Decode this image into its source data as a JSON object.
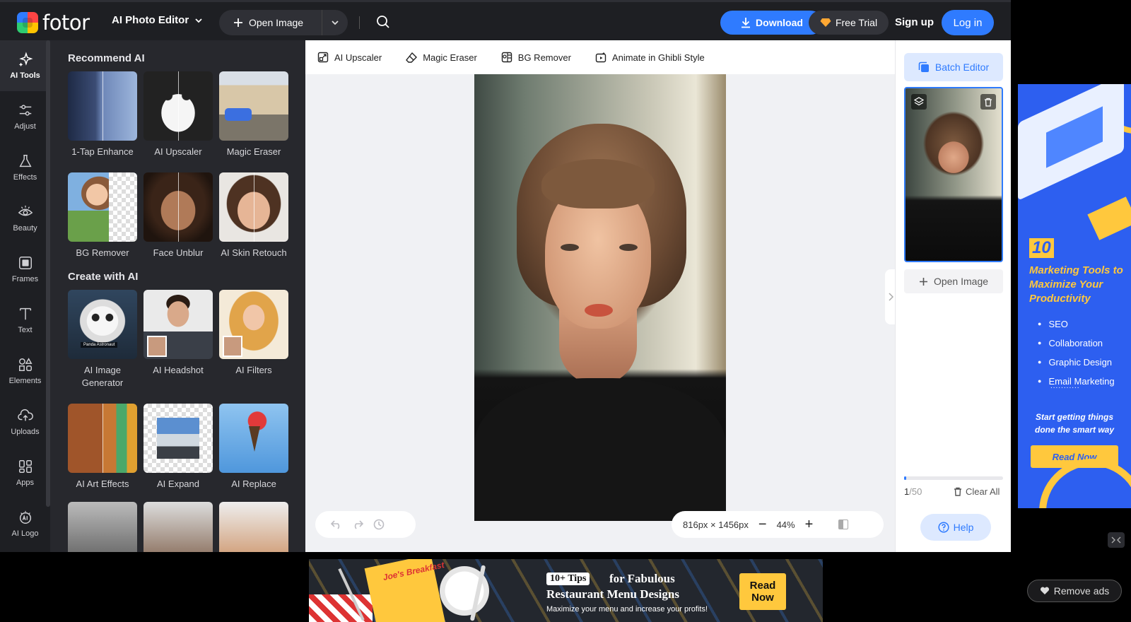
{
  "brand": {
    "name": "fotor"
  },
  "topbar": {
    "editor_menu": "AI Photo Editor",
    "open_image": "Open Image",
    "download": "Download",
    "free_trial": "Free Trial",
    "sign_up": "Sign up",
    "log_in": "Log in"
  },
  "rail": {
    "items": [
      {
        "label": "AI Tools",
        "icon": "sparkle-icon",
        "active": true
      },
      {
        "label": "Adjust",
        "icon": "sliders-icon"
      },
      {
        "label": "Effects",
        "icon": "flask-icon"
      },
      {
        "label": "Beauty",
        "icon": "eye-icon"
      },
      {
        "label": "Frames",
        "icon": "frame-icon"
      },
      {
        "label": "Text",
        "icon": "text-icon"
      },
      {
        "label": "Elements",
        "icon": "shapes-icon"
      },
      {
        "label": "Uploads",
        "icon": "cloud-upload-icon"
      },
      {
        "label": "Apps",
        "icon": "apps-icon"
      },
      {
        "label": "AI Logo",
        "icon": "ai-logo-icon"
      }
    ]
  },
  "panel": {
    "recommend_title": "Recommend AI",
    "recommend": [
      {
        "label": "1-Tap Enhance"
      },
      {
        "label": "AI Upscaler"
      },
      {
        "label": "Magic Eraser"
      },
      {
        "label": "BG Remover"
      },
      {
        "label": "Face Unblur"
      },
      {
        "label": "AI Skin Retouch"
      }
    ],
    "create_title": "Create with AI",
    "create": [
      {
        "label": "AI Image Generator",
        "badge": "Panda Astronaut"
      },
      {
        "label": "AI Headshot"
      },
      {
        "label": "AI Filters"
      },
      {
        "label": "AI Art Effects"
      },
      {
        "label": "AI Expand"
      },
      {
        "label": "AI Replace"
      }
    ]
  },
  "quickbar": {
    "items": [
      {
        "label": "AI Upscaler",
        "icon": "upscale-icon"
      },
      {
        "label": "Magic Eraser",
        "icon": "eraser-icon"
      },
      {
        "label": "BG Remover",
        "icon": "bg-remove-icon"
      },
      {
        "label": "Animate in Ghibli Style",
        "icon": "animate-icon"
      }
    ]
  },
  "canvas": {
    "dimensions": "816px × 1456px",
    "zoom": "44%"
  },
  "rpanel": {
    "batch_editor": "Batch Editor",
    "open_image": "Open Image",
    "count_current": "1",
    "count_total": "/50",
    "progress_fraction": 0.02,
    "clear_all": "Clear All",
    "help": "Help"
  },
  "side_ad": {
    "number": "10",
    "headline": "Marketing Tools to Maximize Your Productivity",
    "bullets": [
      "SEO",
      "Collaboration",
      "Graphic Design",
      "Email Marketing"
    ],
    "dots": "...........",
    "tagline": "Start getting things done the smart way",
    "cta": "Read Now"
  },
  "banner": {
    "menu_title": "Joe's Breakfast",
    "tag": "10+ Tips",
    "line1": "for Fabulous",
    "line2": "Restaurant Menu Designs",
    "sub": "Maximize your menu and increase your profits!",
    "cta_line1": "Read",
    "cta_line2": "Now"
  },
  "remove_ads": "Remove ads",
  "colors": {
    "accent": "#2f7bff",
    "dark_bg": "#1e1f23",
    "panel_bg": "#27282d",
    "ad_blue": "#2d5ff0",
    "ad_yellow": "#ffc83d"
  }
}
